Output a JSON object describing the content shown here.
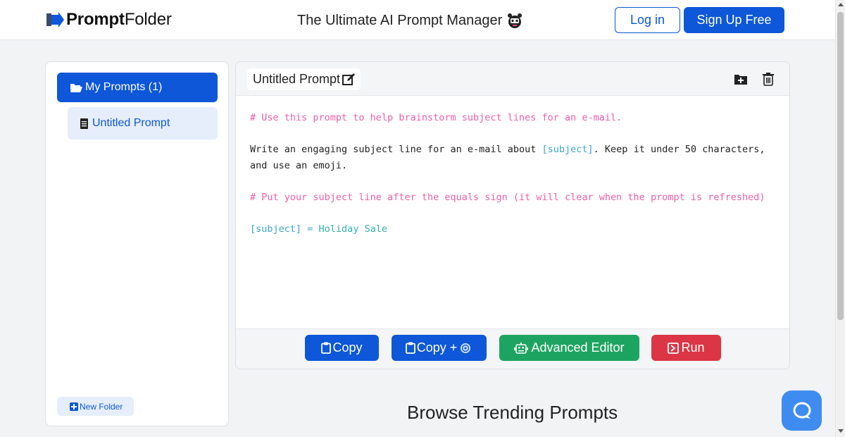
{
  "header": {
    "logo_bold": "Prompt",
    "logo_light": "Folder",
    "tagline": "The Ultimate AI Prompt Manager",
    "login_label": "Log in",
    "signup_label": "Sign Up Free"
  },
  "sidebar": {
    "folder_label": "My Prompts (1)",
    "prompt_label": "Untitled Prompt",
    "new_folder_label": "New Folder"
  },
  "editor": {
    "title": "Untitled Prompt",
    "lines": {
      "comment1": "# Use this prompt to help brainstorm subject lines for an e-mail.",
      "body_part1": "Write an engaging subject line for an e-mail about ",
      "body_var": "[subject]",
      "body_part2": ". Keep it under 50 characters, and use an emoji.",
      "comment2": "# Put your subject line after the equals sign (it will clear when the prompt is refreshed)",
      "assign_var": "[subject]",
      "assign_op": " = ",
      "assign_value": "Holiday Sale"
    },
    "buttons": {
      "copy": "Copy",
      "copy_plus": "Copy +",
      "advanced": "Advanced Editor",
      "run": "Run"
    }
  },
  "trending_heading": "Browse Trending Prompts",
  "colors": {
    "primary": "#0d57d8",
    "success": "#1ea461",
    "danger": "#dc3545",
    "comment": "#ee5fa7",
    "variable": "#3aa8c9",
    "chat": "#3f8cf0"
  },
  "icons": [
    "logo-arrow-icon",
    "robot-icon",
    "folder-open-icon",
    "document-icon",
    "folder-plus-icon",
    "edit-icon",
    "trash-icon",
    "clipboard-icon",
    "openai-icon",
    "robot-editor-icon",
    "run-icon",
    "chat-icon"
  ]
}
